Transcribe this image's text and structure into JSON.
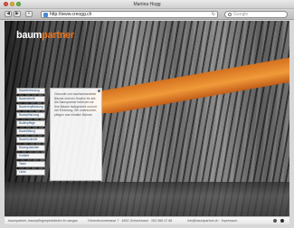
{
  "window": {
    "title": "Martina Hogg"
  },
  "toolbar": {
    "back": "◀",
    "forward": "▶",
    "add": "+",
    "address": "http://www.creogg.ch",
    "reload": "↻",
    "search_placeholder": "Google"
  },
  "logo": {
    "part1": "baum",
    "part2": "partner"
  },
  "nav": {
    "items": [
      {
        "label": "Baumbetreuung"
      },
      {
        "label": "Baumschnitt"
      },
      {
        "label": "Baumverpflanzung"
      },
      {
        "label": "Baumpflanzung"
      },
      {
        "label": "Bodenpflege"
      },
      {
        "label": "Baumfällung"
      },
      {
        "label": "Baumkontrolle"
      },
      {
        "label": "Baumgutachten"
      },
      {
        "label": "Kontakt"
      },
      {
        "label": "Team"
      },
      {
        "label": "Links"
      }
    ]
  },
  "panel": {
    "text": "Gesunde und wachstumsstarke Bäume sind ein Gewinn für alle. Als Baumpartner betreuen wir Ihre Bäume fachgerecht und mit viel Erfahrung. Wir untersuchen, pflegen und erhalten Bäume."
  },
  "footer": {
    "left": "baumpartner, baumpflegespezialisten im aargau",
    "mid": "Hohenbrunnstrasse 7 · 4652 Gretzenbach · 062 858 47 88",
    "right": "info@baumpartner.ch · Impressum"
  }
}
